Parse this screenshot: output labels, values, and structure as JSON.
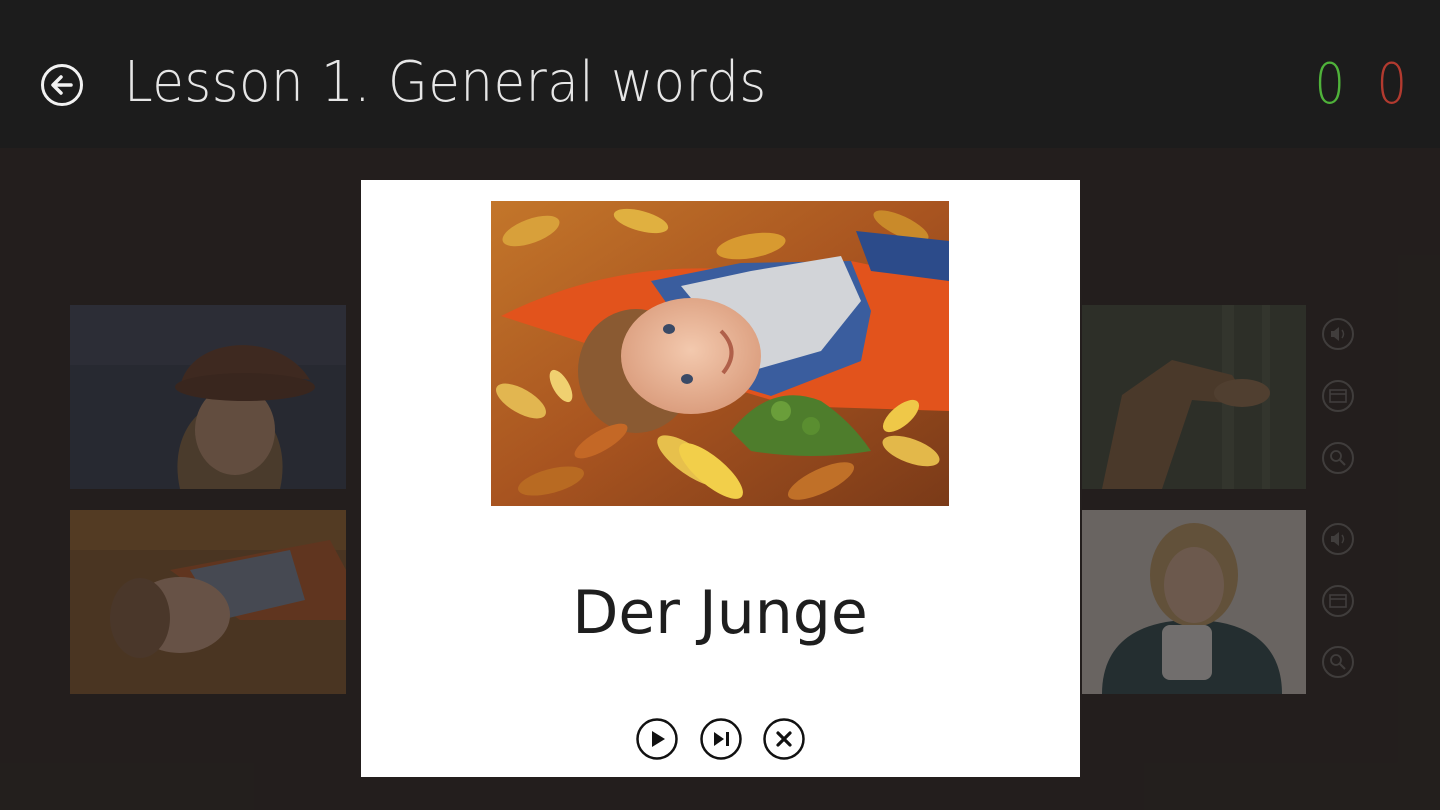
{
  "header": {
    "title": "Lesson 1. General words",
    "back_icon": "back-arrow-circle-icon",
    "score_correct": "0",
    "score_wrong": "0",
    "colors": {
      "correct": "#4fb23a",
      "wrong": "#b23a2f"
    }
  },
  "background_tiles": [
    {
      "picture": "girl-in-brown-hat"
    },
    {
      "picture": "giraffe-in-trees"
    },
    {
      "picture": "boy-lying-in-autumn-leaves"
    },
    {
      "picture": "woman-holding-mug"
    }
  ],
  "side_icons": [
    "speaker-icon",
    "card-icon",
    "magnifier-icon"
  ],
  "modal": {
    "word": "Der Junge",
    "picture": "boy-lying-in-autumn-leaves",
    "controls": [
      "play-icon",
      "skip-next-icon",
      "close-icon"
    ]
  }
}
